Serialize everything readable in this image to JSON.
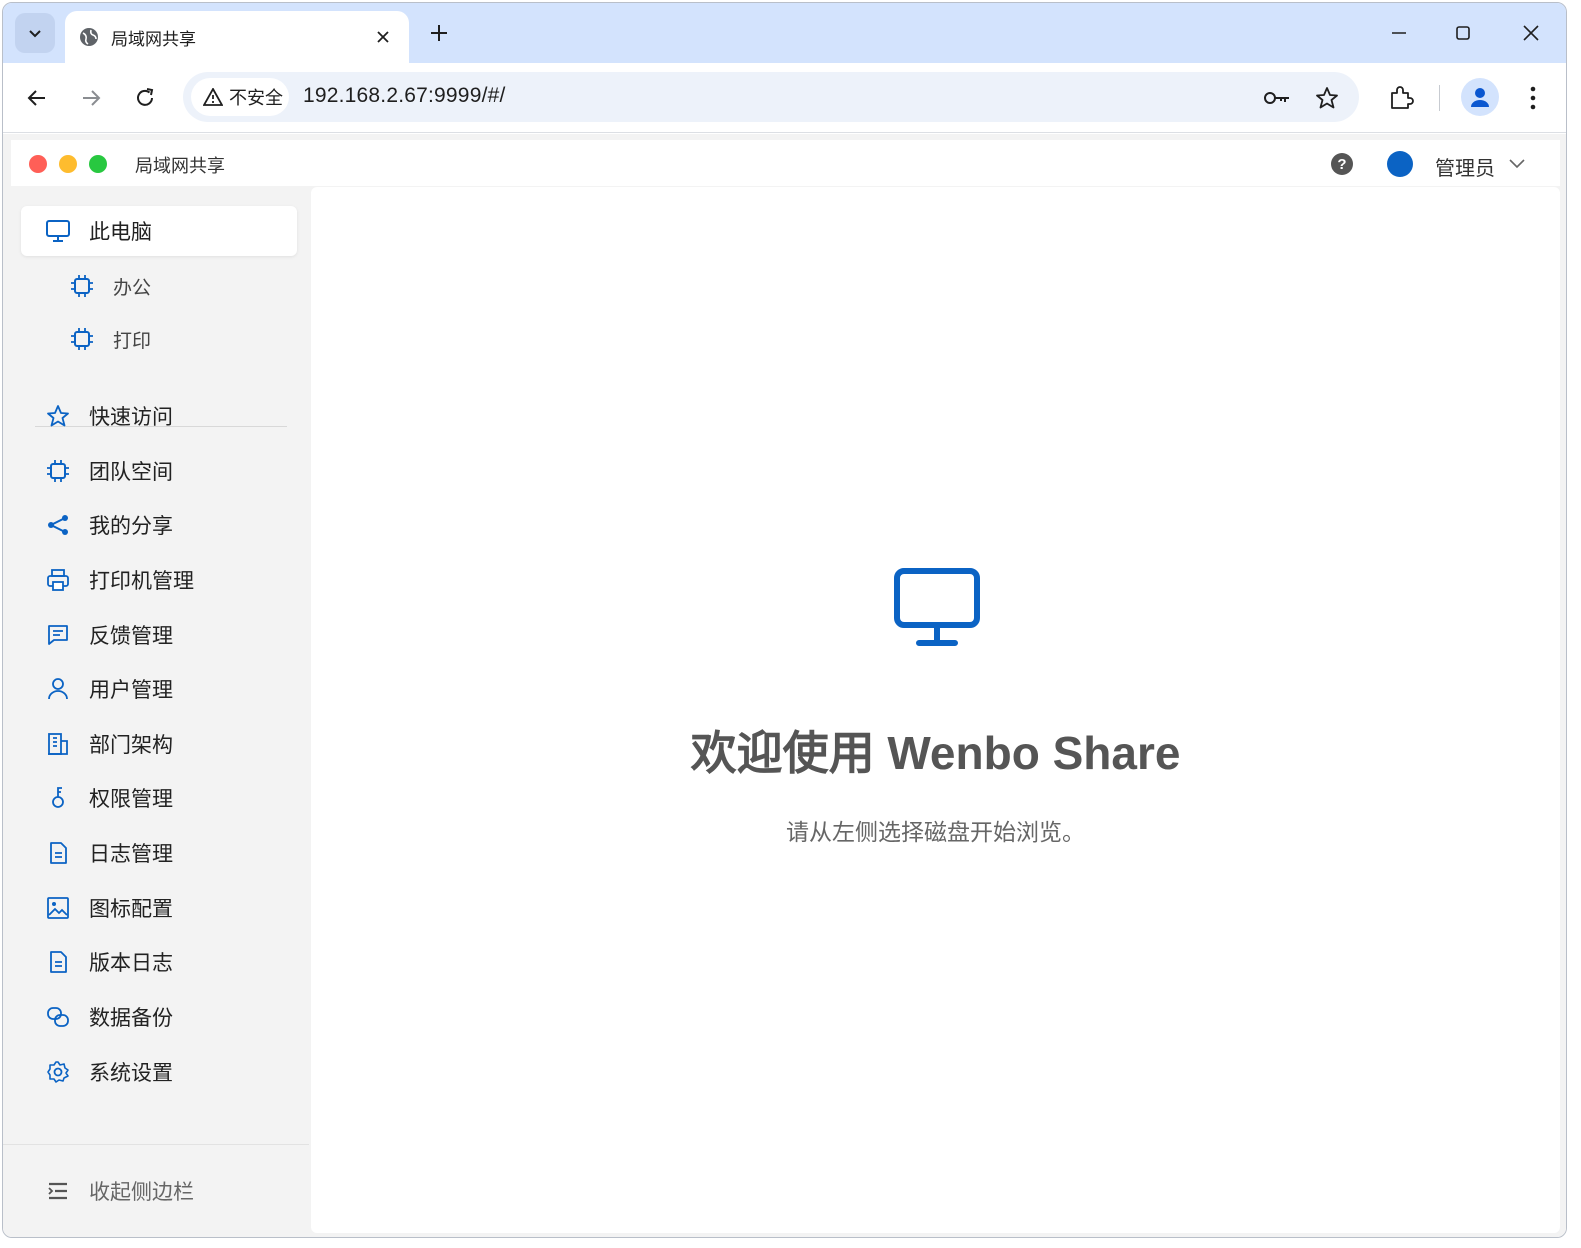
{
  "browser": {
    "tab_title": "局域网共享",
    "security_label": "不安全",
    "url": "192.168.2.67:9999/#/"
  },
  "app": {
    "title": "局域网共享",
    "user": "管理员",
    "help_glyph": "?",
    "colors": {
      "accent": "#0b63c4",
      "dot_red": "#ff5f57",
      "dot_yellow": "#febc2e",
      "dot_green": "#28c840"
    }
  },
  "sidebar": {
    "pc": {
      "label": "此电脑",
      "icon": "monitor-icon"
    },
    "drives": [
      {
        "label": "办公",
        "icon": "chip-icon"
      },
      {
        "label": "打印",
        "icon": "chip-icon"
      }
    ],
    "items": [
      {
        "label": "快速访问",
        "icon": "star-icon"
      },
      {
        "label": "团队空间",
        "icon": "chip-icon"
      },
      {
        "label": "我的分享",
        "icon": "share-icon"
      },
      {
        "label": "打印机管理",
        "icon": "printer-icon"
      },
      {
        "label": "反馈管理",
        "icon": "message-icon"
      },
      {
        "label": "用户管理",
        "icon": "user-icon"
      },
      {
        "label": "部门架构",
        "icon": "building-icon"
      },
      {
        "label": "权限管理",
        "icon": "key-icon"
      },
      {
        "label": "日志管理",
        "icon": "document-icon"
      },
      {
        "label": "图标配置",
        "icon": "image-icon"
      },
      {
        "label": "版本日志",
        "icon": "document-icon"
      },
      {
        "label": "数据备份",
        "icon": "backup-icon"
      },
      {
        "label": "系统设置",
        "icon": "gear-icon"
      }
    ],
    "collapse_label": "收起侧边栏"
  },
  "main": {
    "welcome_title": "欢迎使用 Wenbo Share",
    "welcome_subtitle": "请从左侧选择磁盘开始浏览。"
  }
}
